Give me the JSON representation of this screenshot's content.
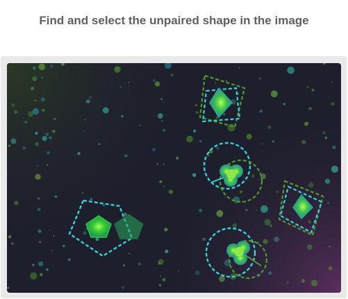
{
  "prompt": {
    "title": "Find and select the unpaired shape in the image"
  },
  "colors": {
    "bg_dark": "#1e1f2c",
    "bg_green_corner": "#2a3a24",
    "bg_purple_corner": "#4b2a4f",
    "ring_cyan": "#3ccfd6",
    "ring_green": "#4f9a2c",
    "shape_green": "#39d22a",
    "shape_teal": "#2aa89a"
  },
  "shapes": [
    {
      "name": "diamond-shape",
      "kind": "diamond",
      "paired": true
    },
    {
      "name": "clover-shape",
      "kind": "clover",
      "paired": true
    },
    {
      "name": "diamond-shape",
      "kind": "diamond",
      "paired": true
    },
    {
      "name": "pentagon-shape",
      "kind": "pentagon",
      "paired": false
    },
    {
      "name": "clover-shape",
      "kind": "clover",
      "paired": true
    }
  ]
}
